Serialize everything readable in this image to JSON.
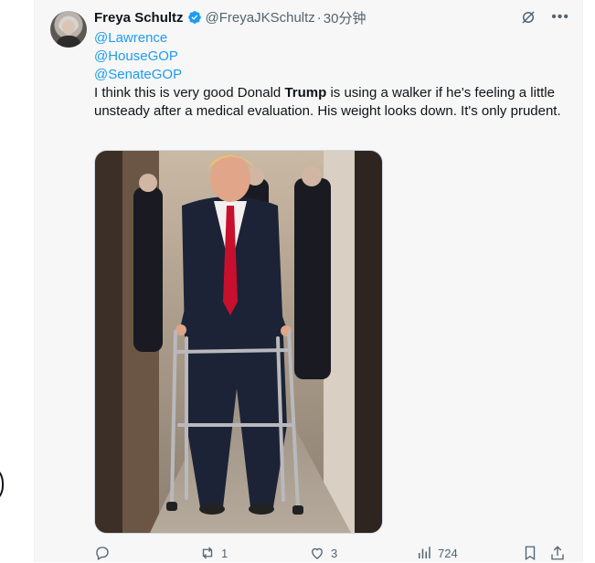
{
  "tweet": {
    "author_name": "Freya Schultz",
    "handle": "@FreyaJKSchultz",
    "separator": "·",
    "time": "30分钟",
    "mentions": [
      "@Lawrence",
      "@HouseGOP",
      "@SenateGOP"
    ],
    "text_before": "I think this is very good Donald ",
    "text_bold": "Trump",
    "text_after": " is using a walker if he's feeling a little unsteady after a medical evaluation.  His weight looks down. It's only prudent.",
    "media_alt": "Photo of a man in a dark suit and red tie walking with a metal walker down a hallway"
  },
  "actions": {
    "reply_count": "",
    "retweet_count": "1",
    "like_count": "3",
    "views_count": "724"
  },
  "colors": {
    "accent": "#1d9bf0",
    "text": "#0f1419",
    "secondary": "#536471",
    "background": "#f7f7f7"
  },
  "icons": [
    "verified-badge-icon",
    "grok-icon",
    "more-icon",
    "reply-icon",
    "retweet-icon",
    "like-icon",
    "views-icon",
    "bookmark-icon",
    "share-icon"
  ]
}
